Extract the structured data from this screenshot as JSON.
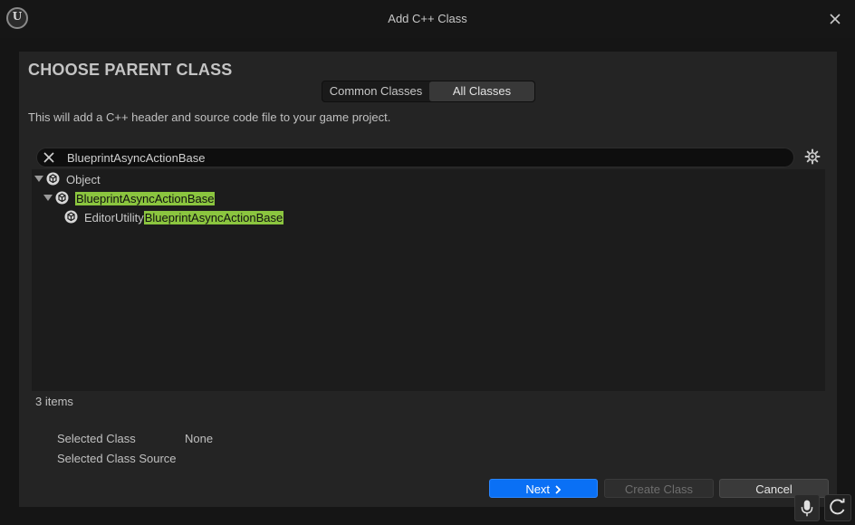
{
  "window": {
    "title": "Add C++ Class"
  },
  "header": {
    "heading": "CHOOSE PARENT CLASS",
    "tabs": [
      {
        "label": "Common Classes",
        "active": false
      },
      {
        "label": "All Classes",
        "active": true
      }
    ],
    "description": "This will add a C++ header and source code file to your game project."
  },
  "search": {
    "value": "BlueprintAsyncActionBase"
  },
  "tree": {
    "rows": [
      {
        "label": "Object",
        "prefix": "",
        "match": "",
        "expanded": true
      },
      {
        "label": "",
        "prefix": "",
        "match": "BlueprintAsyncActionBase",
        "expanded": true
      },
      {
        "label": "",
        "prefix": "EditorUtility",
        "match": "BlueprintAsyncActionBase",
        "expanded": false
      }
    ],
    "count_text": "3 items"
  },
  "details": {
    "selected_class_label": "Selected Class",
    "selected_class_value": "None",
    "selected_source_label": "Selected Class Source",
    "selected_source_value": ""
  },
  "buttons": {
    "next": "Next",
    "create": "Create Class",
    "cancel": "Cancel"
  },
  "colors": {
    "accent": "#0a70f5",
    "highlight": "#8bc53f",
    "background": "#151515",
    "panel": "#242424"
  }
}
